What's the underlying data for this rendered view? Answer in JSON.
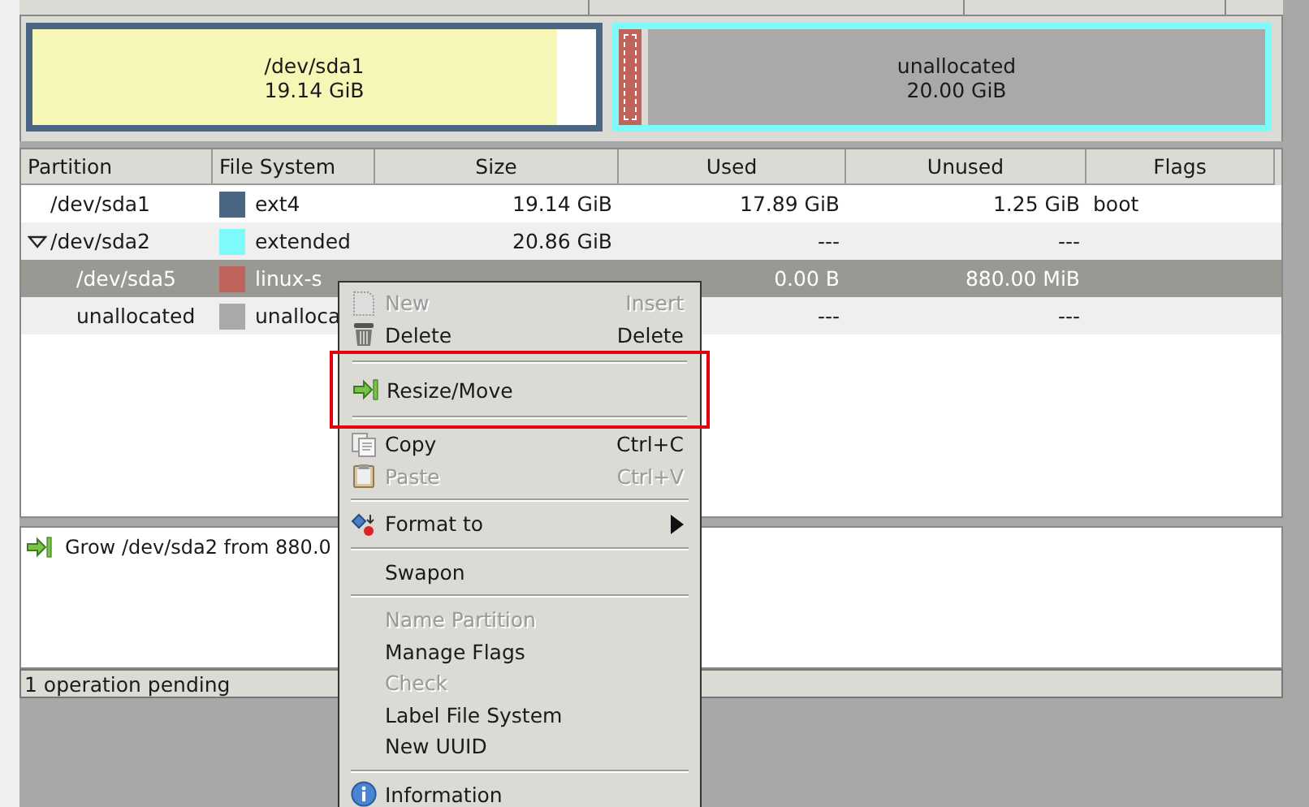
{
  "disk_map": [
    {
      "kind": "primary",
      "name": "/dev/sda1",
      "size": "19.14 GiB",
      "color": "#4b6584",
      "level": 0.93
    },
    {
      "kind": "extended",
      "color": "#7ffafa",
      "children": [
        {
          "kind": "swap",
          "color": "#c0635a",
          "selected": true
        },
        {
          "kind": "unallocated",
          "name": "unallocated",
          "size": "20.00 GiB",
          "color": "#a9a9a9"
        }
      ]
    }
  ],
  "table": {
    "columns": [
      "Partition",
      "File System",
      "Size",
      "Used",
      "Unused",
      "Flags"
    ],
    "rows": [
      {
        "partition": "/dev/sda1",
        "color": "#4b6584",
        "file_system": "ext4",
        "size": "19.14 GiB",
        "used": "17.89 GiB",
        "unused": "1.25 GiB",
        "flags": "boot",
        "selected": false
      },
      {
        "partition": "/dev/sda2",
        "color": "#7ffafa",
        "file_system": "extended",
        "size": "20.86 GiB",
        "used": "---",
        "unused": "---",
        "selected": false,
        "expanded": true,
        "children": [
          {
            "partition": "/dev/sda5",
            "color": "#c0635a",
            "file_system": "linux-s",
            "used": "0.00 B",
            "unused": "880.00 MiB",
            "selected": true
          },
          {
            "partition": "unallocated",
            "color": "#a9a9a9",
            "file_system": "unalloca",
            "used": "---",
            "unused": "---",
            "selected": false
          }
        ]
      }
    ]
  },
  "operations": [
    {
      "text": "Grow /dev/sda2 from 880.0"
    }
  ],
  "status_bar": "1 operation pending",
  "context_menu": [
    {
      "kind": "new",
      "label": "New",
      "shortcut": "Insert",
      "disabled": true
    },
    {
      "kind": "delete",
      "label": "Delete",
      "shortcut": "Delete",
      "disabled": false
    },
    {
      "kind": "separator"
    },
    {
      "kind": "resize",
      "label": "Resize/Move",
      "disabled": false,
      "highlighted": true
    },
    {
      "kind": "separator"
    },
    {
      "kind": "copy",
      "label": "Copy",
      "shortcut": "Ctrl+C",
      "disabled": false
    },
    {
      "kind": "paste",
      "label": "Paste",
      "shortcut": "Ctrl+V",
      "disabled": true
    },
    {
      "kind": "separator"
    },
    {
      "kind": "format",
      "label": "Format to",
      "submenu": true,
      "disabled": false
    },
    {
      "kind": "separator"
    },
    {
      "kind": "plain",
      "label": "Swapon",
      "disabled": false
    },
    {
      "kind": "separator"
    },
    {
      "kind": "plain",
      "label": "Name Partition",
      "disabled": true
    },
    {
      "kind": "plain",
      "label": "Manage Flags",
      "disabled": false
    },
    {
      "kind": "plain",
      "label": "Check",
      "disabled": true
    },
    {
      "kind": "plain",
      "label": "Label File System",
      "disabled": false
    },
    {
      "kind": "plain",
      "label": "New UUID",
      "disabled": false
    },
    {
      "kind": "separator"
    },
    {
      "kind": "info",
      "label": "Information",
      "disabled": false
    }
  ]
}
